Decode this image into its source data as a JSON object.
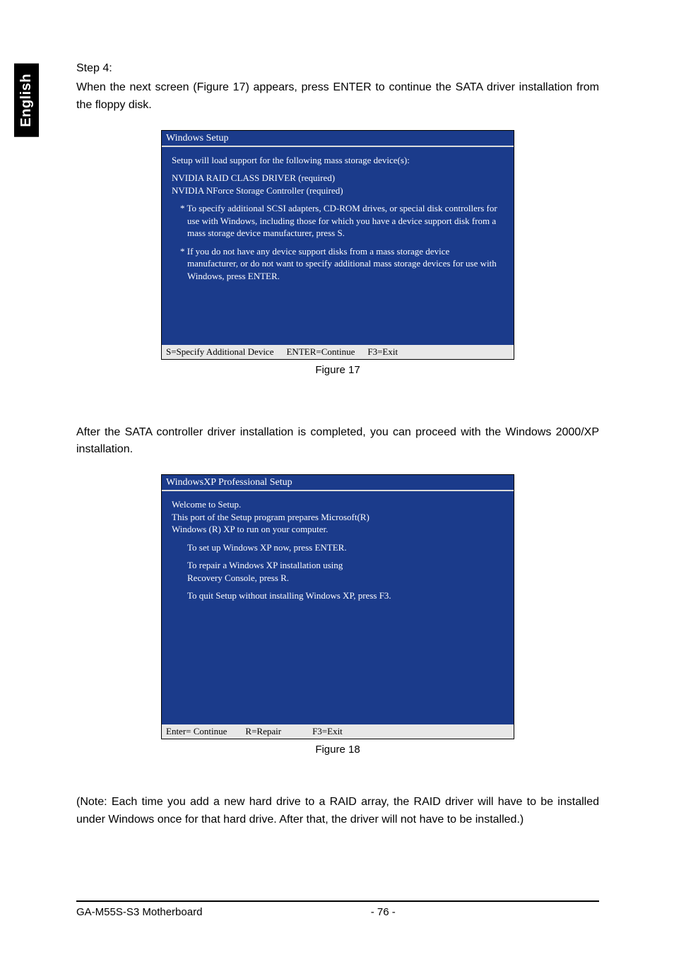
{
  "sideTab": "English",
  "step": {
    "label": "Step 4:",
    "text": "When the next screen (Figure 17) appears, press ENTER to continue the SATA driver installation from the floppy disk."
  },
  "figure17": {
    "title": "Windows Setup",
    "line1": "Setup will load support for the following mass storage device(s):",
    "driver1": "NVIDIA RAID CLASS DRIVER (required)",
    "driver2": "NVIDIA NForce Storage Controller (required)",
    "bullet1": "* To specify additional SCSI adapters, CD-ROM drives, or special disk  controllers for use with Windows, including those for which you have a device support disk from a mass storage device manufacturer, press S.",
    "bullet2": "* If you do not have any device support disks from a mass storage device manufacturer, or do not want to specify additional mass storage devices for use with Windows, press ENTER.",
    "status": {
      "s": "S=Specify Additional Device",
      "enter": "ENTER=Continue",
      "f3": "F3=Exit"
    },
    "caption": "Figure 17"
  },
  "midText": "After the SATA controller driver installation is completed, you can proceed with the Windows 2000/XP installation.",
  "figure18": {
    "title": "WindowsXP Professional  Setup",
    "welcome": "Welcome to Setup.",
    "line2": "This port of the Setup program prepares Microsoft(R)",
    "line3": "Windows (R) XP  to run on your computer.",
    "opt1": "To set up Windows XP now, press ENTER.",
    "opt2a": "To repair a Windows XP installation using",
    "opt2b": "Recovery Console, press R.",
    "opt3": "To quit Setup without installing Windows XP, press F3.",
    "status": {
      "enter": "Enter= Continue",
      "r": "R=Repair",
      "f3": "F3=Exit"
    },
    "caption": "Figure 18"
  },
  "note": "(Note: Each time you add a new hard drive to a RAID array, the RAID driver will have to be installed under Windows once for that hard drive. After that, the driver will not have to be installed.)",
  "footer": {
    "left": "GA-M55S-S3 Motherboard",
    "center": "- 76 -"
  }
}
